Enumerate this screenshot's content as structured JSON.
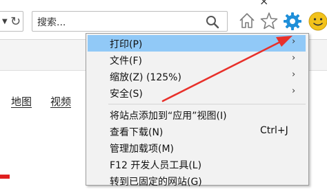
{
  "toolbar": {
    "dropdown_glyph": "▼",
    "refresh_glyph": "↻",
    "close_glyph": "×",
    "search_placeholder": "搜索...",
    "icons": [
      "search-icon",
      "home-icon",
      "star-icon",
      "gear-icon",
      "smiley-icon"
    ]
  },
  "page": {
    "links": [
      "地图",
      "视频"
    ]
  },
  "menu": {
    "items": [
      {
        "label": "打印(P)",
        "arrow": "›",
        "highlighted": true
      },
      {
        "label": "文件(F)",
        "arrow": "›"
      },
      {
        "label": "缩放(Z) (125%)",
        "arrow": "›"
      },
      {
        "label": "安全(S)",
        "arrow": "›"
      },
      {
        "label": "将站点添加到“应用”视图(I)"
      },
      {
        "label": "查看下载(N)",
        "shortcut": "Ctrl+J"
      },
      {
        "label": "管理加载项(M)"
      },
      {
        "label": "F12 开发人员工具(L)"
      },
      {
        "label": "转到已固定的网站(G)"
      }
    ]
  },
  "colors": {
    "highlight": "#91c9f7",
    "gear": "#1f8fd9",
    "annotation_arrow": "#e8302a",
    "smiley": "#f2c21b"
  }
}
